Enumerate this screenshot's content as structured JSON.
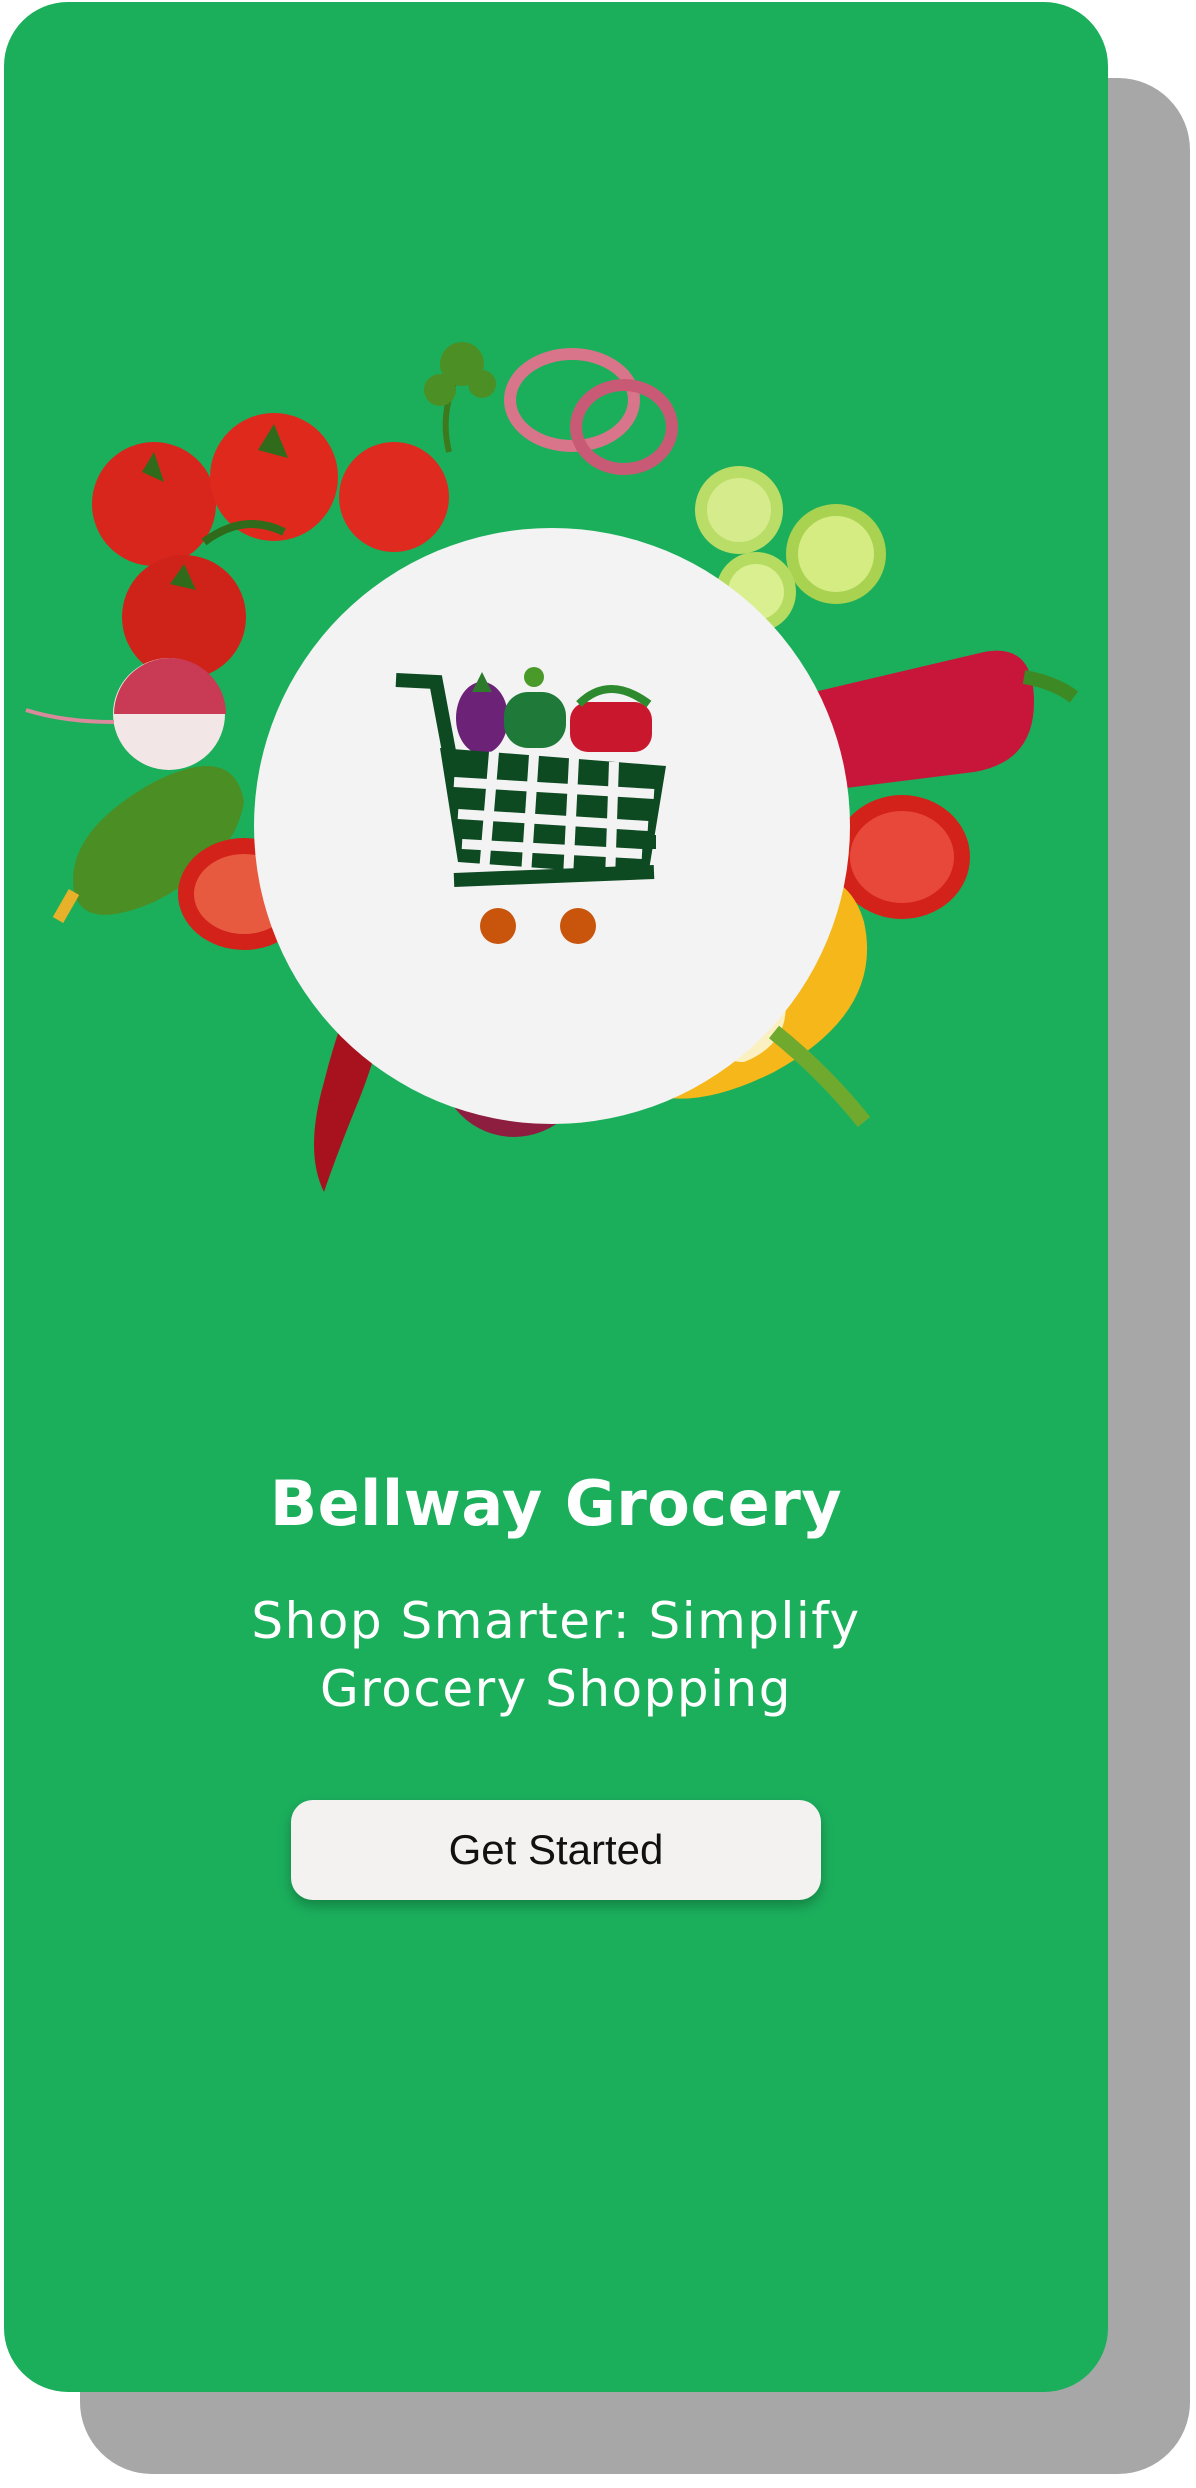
{
  "app": {
    "title": "Bellway Grocery",
    "tagline": "Shop Smarter: Simplify Grocery Shopping",
    "cta_label": "Get Started"
  },
  "hero": {
    "logo_icon": "shopping-cart-with-vegetables-icon",
    "decor": [
      "tomatoes",
      "onion-rings",
      "cucumber-slices",
      "red-bell-pepper",
      "radish",
      "cucumber",
      "red-chili",
      "red-onion",
      "yellow-bell-pepper",
      "parsley"
    ]
  },
  "colors": {
    "background": "#1baf5c",
    "button_bg": "#f4f1f1",
    "text_primary": "#ffffff",
    "cart": "#0d4a22",
    "wheels": "#c9550c"
  }
}
